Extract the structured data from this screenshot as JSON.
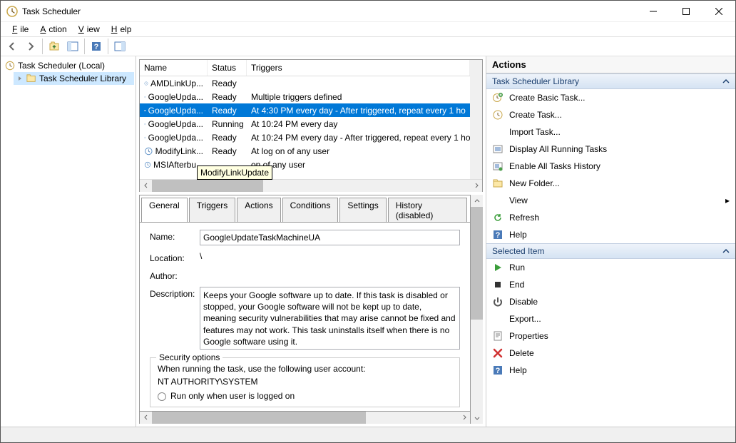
{
  "window": {
    "title": "Task Scheduler"
  },
  "menu": {
    "file": "File",
    "action": "Action",
    "view": "View",
    "help": "Help"
  },
  "tree": {
    "root": "Task Scheduler (Local)",
    "library": "Task Scheduler Library"
  },
  "list": {
    "headers": {
      "name": "Name",
      "status": "Status",
      "triggers": "Triggers"
    },
    "rows": [
      {
        "name": "AMDLinkUp...",
        "status": "Ready",
        "triggers": ""
      },
      {
        "name": "GoogleUpda...",
        "status": "Ready",
        "triggers": "Multiple triggers defined"
      },
      {
        "name": "GoogleUpda...",
        "status": "Ready",
        "triggers": "At 4:30 PM every day - After triggered, repeat every 1 ho",
        "selected": true
      },
      {
        "name": "GoogleUpda...",
        "status": "Running",
        "triggers": "At 10:24 PM every day"
      },
      {
        "name": "GoogleUpda...",
        "status": "Ready",
        "triggers": "At 10:24 PM every day - After triggered, repeat every 1 ho"
      },
      {
        "name": "ModifyLink...",
        "status": "Ready",
        "triggers": "At log on of any user"
      },
      {
        "name": "MSIAfterbu...",
        "status": "",
        "triggers": "                              on of any user"
      }
    ],
    "tooltip": "ModifyLinkUpdate"
  },
  "tabs": {
    "general": "General",
    "triggers": "Triggers",
    "actions": "Actions",
    "conditions": "Conditions",
    "settings": "Settings",
    "history": "History (disabled)"
  },
  "general": {
    "name_label": "Name:",
    "name_value": "GoogleUpdateTaskMachineUA",
    "location_label": "Location:",
    "location_value": "\\",
    "author_label": "Author:",
    "author_value": "",
    "description_label": "Description:",
    "description_value": "Keeps your Google software up to date. If this task is disabled or stopped, your Google software will not be kept up to date, meaning security vulnerabilities that may arise cannot be fixed and features may not work. This task uninstalls itself when there is no Google software using it.",
    "security_legend": "Security options",
    "security_text": "When running the task, use the following user account:",
    "security_account": "NT AUTHORITY\\SYSTEM",
    "radio_logged_on": "Run only when user is logged on"
  },
  "actions": {
    "header": "Actions",
    "section1": "Task Scheduler Library",
    "section2": "Selected Item",
    "items1": [
      "Create Basic Task...",
      "Create Task...",
      "Import Task...",
      "Display All Running Tasks",
      "Enable All Tasks History",
      "New Folder...",
      "View",
      "Refresh",
      "Help"
    ],
    "items2": [
      "Run",
      "End",
      "Disable",
      "Export...",
      "Properties",
      "Delete",
      "Help"
    ]
  }
}
